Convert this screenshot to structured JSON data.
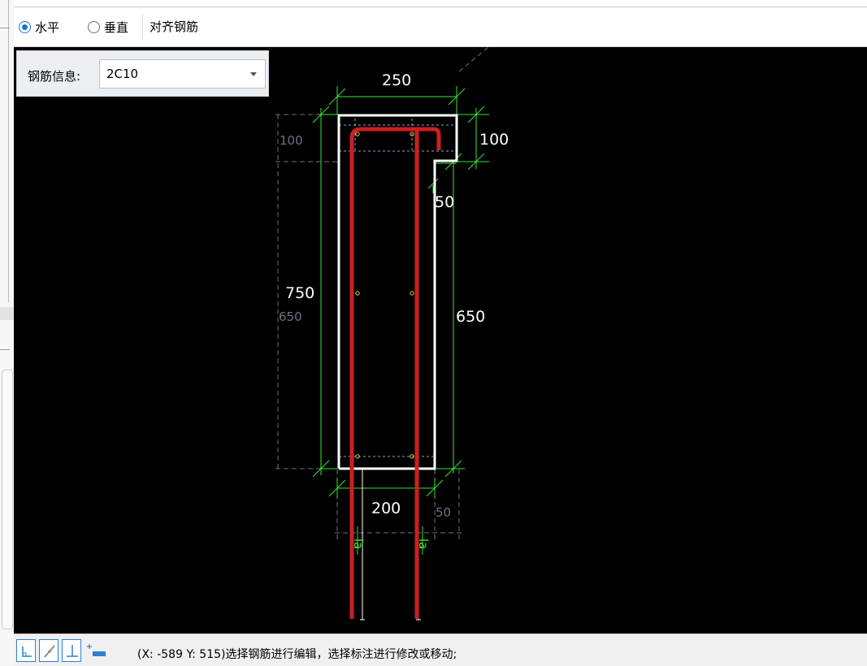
{
  "toolbar": {
    "radio_horizontal": "水平",
    "radio_vertical": "垂直",
    "selected_orientation": "水平",
    "align_button": "对齐钢筋"
  },
  "rebar_info": {
    "label": "钢筋信息:",
    "value": "2C10"
  },
  "drawing": {
    "dim_top_width": "250",
    "dim_top_right_height": "100",
    "dim_left_top_grey": "100",
    "dim_step": "50",
    "dim_total_height": "750",
    "dim_left_grey_height": "650",
    "dim_right_height": "650",
    "dim_bottom_width": "200",
    "dim_bottom_right_grey": "50",
    "anchor_label_left": "la",
    "anchor_label_right": "la"
  },
  "colors": {
    "canvas_bg": "#000000",
    "section_outline": "#ffffff",
    "rebar": "#cc1f1f",
    "dimension": "#39e639",
    "grey_dimension": "#6e7480",
    "accent": "#1a73c9"
  },
  "statusbar": {
    "tools": [
      "corner-snap-icon",
      "line-snap-icon",
      "perpendicular-snap-icon",
      "dimension-icon"
    ],
    "message": "(X: -589 Y: 515)选择钢筋进行编辑，选择标注进行修改或移动;"
  }
}
